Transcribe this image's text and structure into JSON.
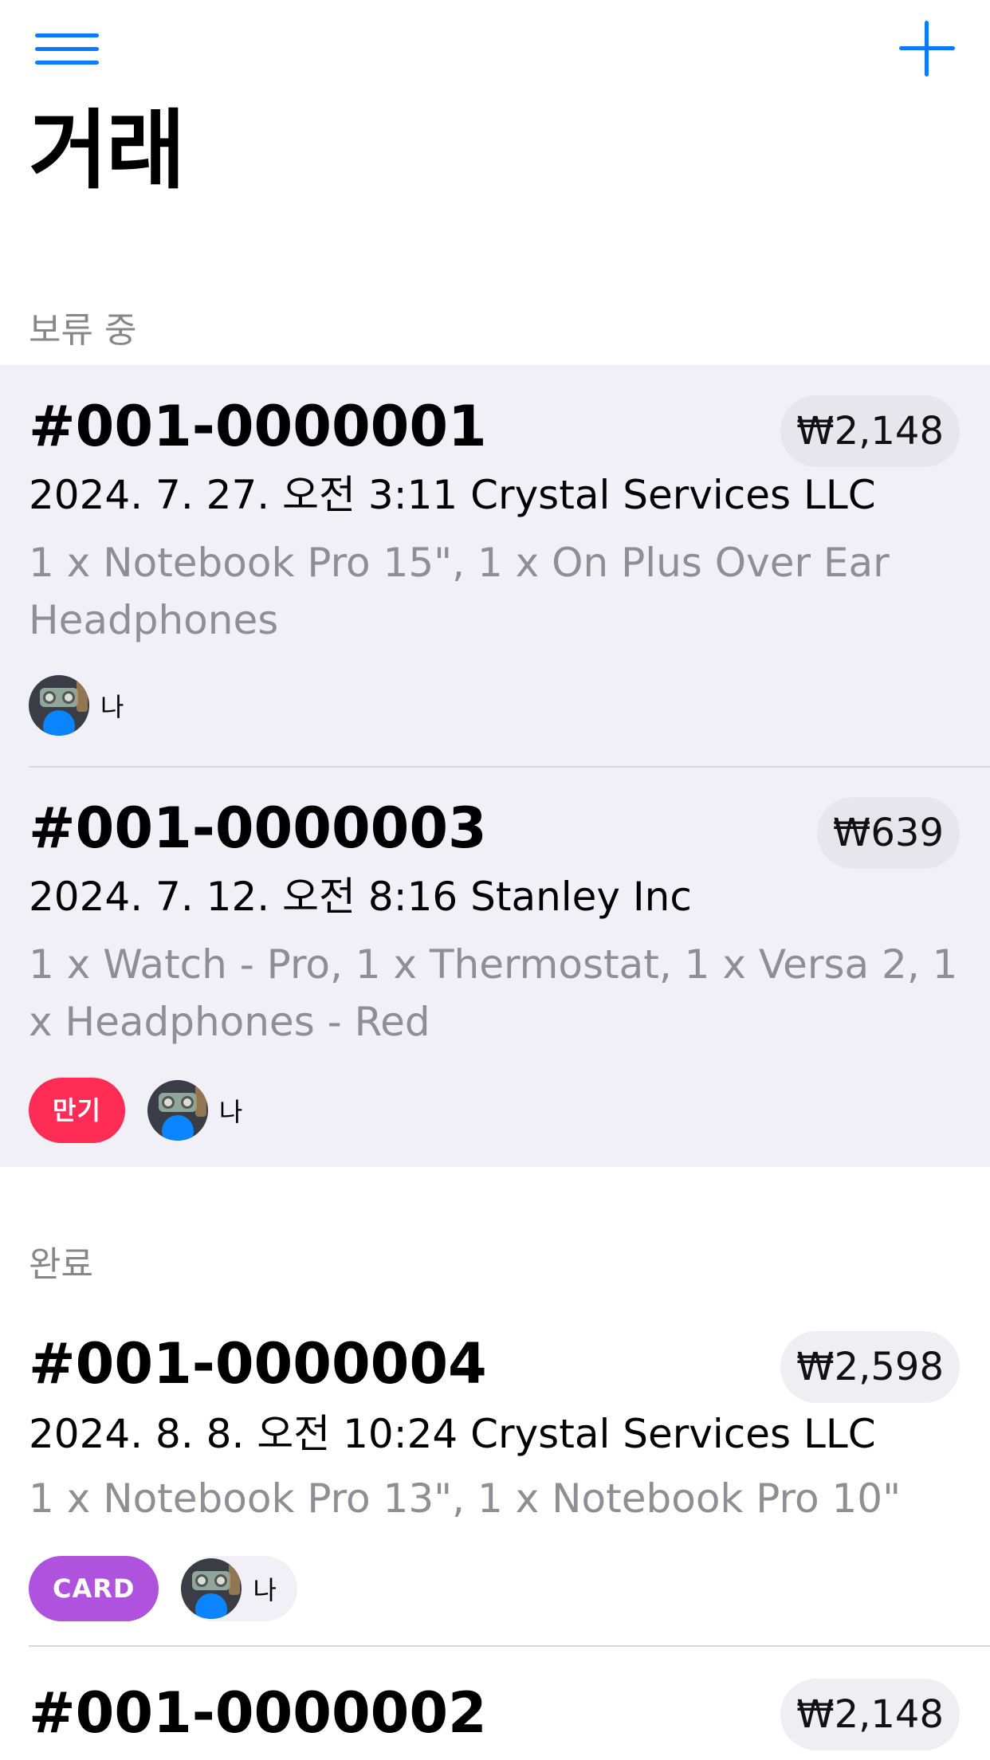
{
  "nav": {
    "menu_icon": "hamburger-icon",
    "add_icon": "plus-icon",
    "title": "거래"
  },
  "colors": {
    "accent": "#0a7aff",
    "overdue_badge": "#ff2d55",
    "card_badge": "#af52de",
    "pending_background": "#f1f0f6"
  },
  "sections": {
    "pending": {
      "header": "보류 중",
      "rows": [
        {
          "id": "#001-0000001",
          "amount": "₩2,148",
          "date_customer": "2024. 7. 27. 오전 3:11 Crystal Services LLC",
          "items": "1 x Notebook Pro 15\", 1 x On Plus Over Ear Headphones",
          "person": "나"
        },
        {
          "id": "#001-0000003",
          "amount": "₩639",
          "date_customer": "2024. 7. 12. 오전 8:16 Stanley Inc",
          "items": "1 x Watch - Pro, 1 x Thermostat, 1 x Versa 2, 1 x Headphones - Red",
          "badge": "만기",
          "person": "나"
        }
      ]
    },
    "completed": {
      "header": "완료",
      "rows": [
        {
          "id": "#001-0000004",
          "amount": "₩2,598",
          "date_customer": "2024. 8. 8. 오전 10:24 Crystal Services LLC",
          "items": "1 x Notebook Pro 13\", 1 x Notebook Pro 10\"",
          "badge": "CARD",
          "person": "나"
        },
        {
          "id": "#001-0000002",
          "amount": "₩2,148"
        }
      ]
    }
  }
}
